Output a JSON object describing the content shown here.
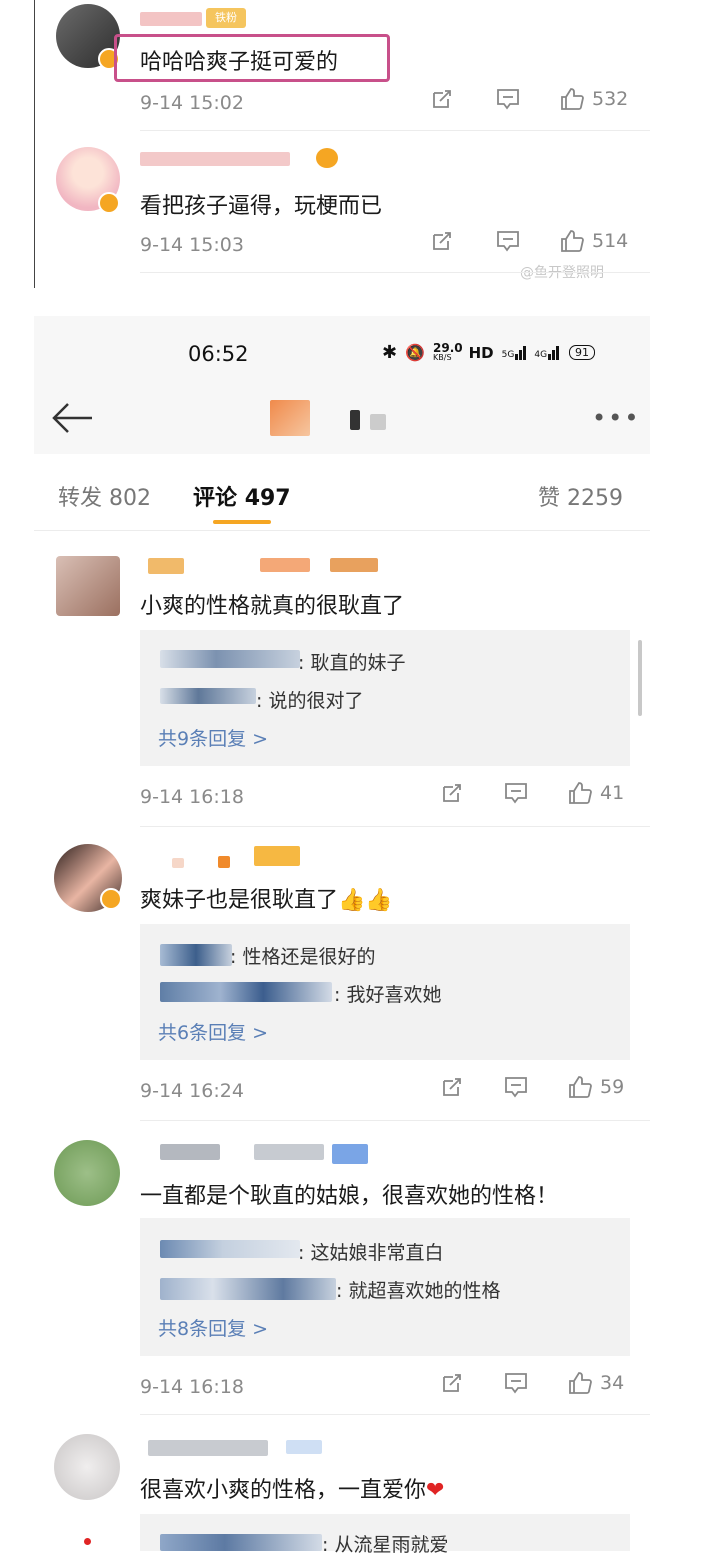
{
  "top_comments": [
    {
      "text": "哈哈哈爽子挺可爱的",
      "time": "9-14 15:02",
      "likes": "532",
      "tag": "铁粉"
    },
    {
      "text": "看把孩子逼得，玩梗而已",
      "time": "9-14 15:03",
      "likes": "514"
    }
  ],
  "watermark": "@鱼开登照明",
  "status_bar": {
    "time": "06:52",
    "speed_value": "29.0",
    "speed_unit": "KB/S",
    "hd": "HD",
    "net1": "5G",
    "net2": "4G",
    "battery": "91"
  },
  "tabs": {
    "repost_label": "转发",
    "repost_count": "802",
    "comment_label": "评论",
    "comment_count": "497",
    "like_label": "赞",
    "like_count": "2259"
  },
  "comments": [
    {
      "text": "小爽的性格就真的很耿直了",
      "replies": [
        ": 耿直的妹子",
        ": 说的很对了"
      ],
      "more": "共9条回复 >",
      "time": "9-14 16:18",
      "likes": "41"
    },
    {
      "text": "爽妹子也是很耿直了👍👍",
      "replies": [
        ": 性格还是很好的",
        ": 我好喜欢她"
      ],
      "more": "共6条回复 >",
      "time": "9-14 16:24",
      "likes": "59"
    },
    {
      "text": "一直都是个耿直的姑娘，很喜欢她的性格！",
      "replies": ": 这姑娘非常直白",
      "replies2": ": 就超喜欢她的性格",
      "more": "共8条回复 >",
      "time": "9-14 16:18",
      "likes": "34"
    },
    {
      "text": "很喜欢小爽的性格，一直爱你",
      "heart": "❤",
      "replies": [
        ": 从流星雨就爱"
      ]
    }
  ],
  "colors": {
    "accent": "#f5a623",
    "highlight_box": "#c8508a",
    "link": "#5a7fb6",
    "heart": "#e02424"
  }
}
